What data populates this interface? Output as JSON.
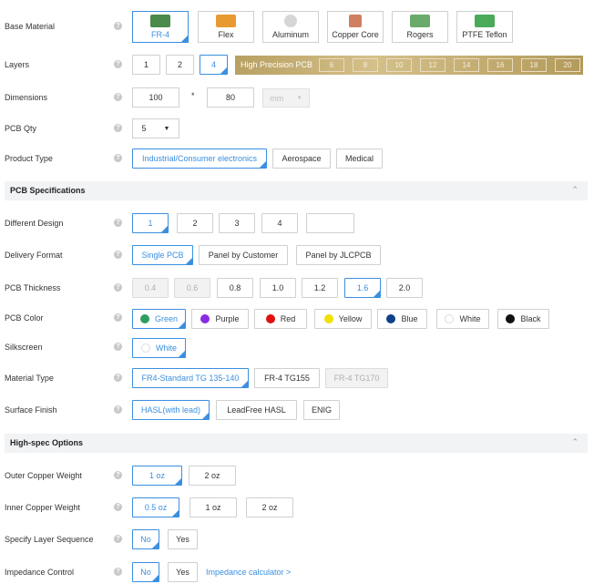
{
  "base_material": {
    "label": "Base Material",
    "options": [
      {
        "label": "FR-4",
        "color": "#4a8a4a"
      },
      {
        "label": "Flex",
        "color": "#e89a30"
      },
      {
        "label": "Aluminum",
        "color": "#cfcfcf"
      },
      {
        "label": "Copper Core",
        "color": "#d08060"
      },
      {
        "label": "Rogers",
        "color": "#6aaa6a"
      },
      {
        "label": "PTFE Teflon",
        "color": "#4aaa5a"
      }
    ]
  },
  "layers": {
    "label": "Layers",
    "options": [
      "1",
      "2",
      "4"
    ],
    "high_precision_label": "High Precision PCB",
    "high_options": [
      "6",
      "8",
      "10",
      "12",
      "14",
      "16",
      "18",
      "20"
    ]
  },
  "dimensions": {
    "label": "Dimensions",
    "width": "100",
    "times": "*",
    "height": "80",
    "unit": "mm"
  },
  "pcb_qty": {
    "label": "PCB Qty",
    "value": "5"
  },
  "product_type": {
    "label": "Product Type",
    "options": [
      "Industrial/Consumer electronics",
      "Aerospace",
      "Medical"
    ]
  },
  "pcb_specifications": {
    "title": "PCB Specifications"
  },
  "different_design": {
    "label": "Different Design",
    "options": [
      "1",
      "2",
      "3",
      "4",
      ""
    ]
  },
  "delivery_format": {
    "label": "Delivery Format",
    "options": [
      "Single PCB",
      "Panel by Customer",
      "Panel by JLCPCB"
    ]
  },
  "pcb_thickness": {
    "label": "PCB Thickness",
    "options": [
      "0.4",
      "0.6",
      "0.8",
      "1.0",
      "1.2",
      "1.6",
      "2.0"
    ]
  },
  "pcb_color": {
    "label": "PCB Color",
    "options": [
      {
        "label": "Green",
        "color": "#2e9e5e"
      },
      {
        "label": "Purple",
        "color": "#8a2be2"
      },
      {
        "label": "Red",
        "color": "#e01010"
      },
      {
        "label": "Yellow",
        "color": "#f2e000"
      },
      {
        "label": "Blue",
        "color": "#10408a"
      },
      {
        "label": "White",
        "color": "#ffffff"
      },
      {
        "label": "Black",
        "color": "#111111"
      }
    ]
  },
  "silkscreen": {
    "label": "Silkscreen",
    "value": "White"
  },
  "material_type": {
    "label": "Material Type",
    "options": [
      "FR4-Standard TG 135-140",
      "FR-4 TG155",
      "FR-4 TG170"
    ]
  },
  "surface_finish": {
    "label": "Surface Finish",
    "options": [
      "HASL(with lead)",
      "LeadFree HASL",
      "ENIG"
    ]
  },
  "high_spec": {
    "title": "High-spec Options"
  },
  "outer_copper": {
    "label": "Outer Copper Weight",
    "options": [
      "1 oz",
      "2 oz"
    ]
  },
  "inner_copper": {
    "label": "Inner Copper Weight",
    "options": [
      "0.5 oz",
      "1 oz",
      "2 oz"
    ]
  },
  "layer_sequence": {
    "label": "Specify Layer Sequence",
    "options": [
      "No",
      "Yes"
    ]
  },
  "impedance": {
    "label": "Impedance Control",
    "options": [
      "No",
      "Yes"
    ],
    "link": "Impedance calculator >"
  },
  "help_glyph": "?",
  "chevron_up": "⌃",
  "caret_down": "▼"
}
